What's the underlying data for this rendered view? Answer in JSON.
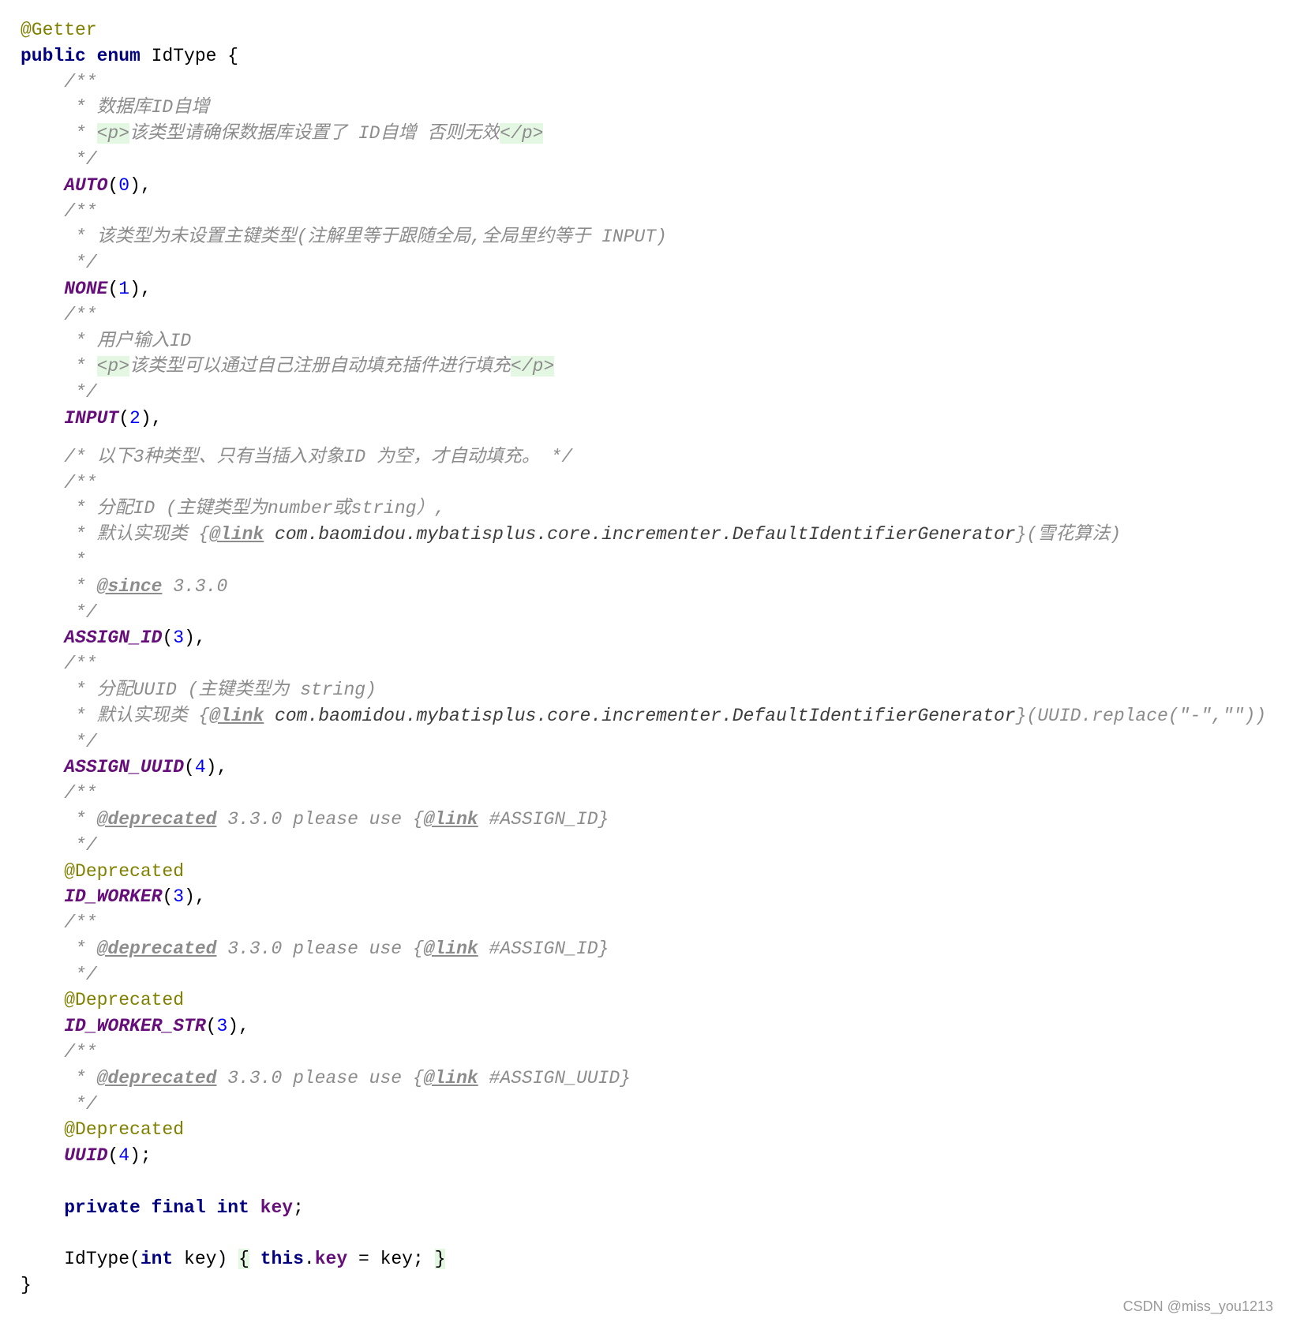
{
  "editor": {
    "language": "java",
    "lines": [
      {
        "segs": [
          [
            "ann",
            "@Getter"
          ]
        ]
      },
      {
        "segs": [
          [
            "kw",
            "public enum "
          ],
          [
            "plain",
            "IdType {"
          ]
        ]
      },
      {
        "segs": [
          [
            "cm",
            "    /**"
          ]
        ]
      },
      {
        "segs": [
          [
            "cm",
            "     * 数据库ID自增"
          ]
        ]
      },
      {
        "segs": [
          [
            "cm",
            "     * "
          ],
          [
            "tag",
            "<p>"
          ],
          [
            "cm",
            "该类型请确保数据库设置了 ID自增 否则无效"
          ],
          [
            "tag",
            "</p>"
          ]
        ]
      },
      {
        "segs": [
          [
            "cm",
            "     */"
          ]
        ]
      },
      {
        "segs": [
          [
            "plain",
            "    "
          ],
          [
            "const",
            "AUTO"
          ],
          [
            "plain",
            "("
          ],
          [
            "num",
            "0"
          ],
          [
            "plain",
            "),"
          ]
        ]
      },
      {
        "segs": [
          [
            "cm",
            "    /**"
          ]
        ]
      },
      {
        "segs": [
          [
            "cm",
            "     * 该类型为未设置主键类型(注解里等于跟随全局,全局里约等于 INPUT)"
          ]
        ]
      },
      {
        "segs": [
          [
            "cm",
            "     */"
          ]
        ]
      },
      {
        "segs": [
          [
            "plain",
            "    "
          ],
          [
            "const",
            "NONE"
          ],
          [
            "plain",
            "("
          ],
          [
            "num",
            "1"
          ],
          [
            "plain",
            "),"
          ]
        ]
      },
      {
        "segs": [
          [
            "cm",
            "    /**"
          ]
        ]
      },
      {
        "segs": [
          [
            "cm",
            "     * 用户输入ID"
          ]
        ]
      },
      {
        "segs": [
          [
            "cm",
            "     * "
          ],
          [
            "tag",
            "<p>"
          ],
          [
            "cm",
            "该类型可以通过自己注册自动填充插件进行填充"
          ],
          [
            "tag",
            "</p>"
          ]
        ]
      },
      {
        "segs": [
          [
            "cm",
            "     */"
          ]
        ]
      },
      {
        "segs": [
          [
            "plain",
            "    "
          ],
          [
            "const",
            "INPUT"
          ],
          [
            "plain",
            "("
          ],
          [
            "num",
            "2"
          ],
          [
            "plain",
            "),"
          ]
        ]
      },
      {
        "gap": "half",
        "segs": [
          [
            "cm",
            "    /* 以下3种类型、只有当插入对象ID 为空，才自动填充。 */"
          ]
        ]
      },
      {
        "segs": [
          [
            "cm",
            "    /**"
          ]
        ]
      },
      {
        "segs": [
          [
            "cm",
            "     * 分配ID (主键类型为number或string）,"
          ]
        ]
      },
      {
        "segs": [
          [
            "cm",
            "     * 默认实现类 {"
          ],
          [
            "doctag",
            "@link"
          ],
          [
            "ref",
            " com.baomidou.mybatisplus.core.incrementer.DefaultIdentifierGenerator"
          ],
          [
            "cm",
            "}(雪花算法)"
          ]
        ]
      },
      {
        "segs": [
          [
            "cm",
            "     *"
          ]
        ]
      },
      {
        "segs": [
          [
            "cm",
            "     * "
          ],
          [
            "doctag",
            "@since"
          ],
          [
            "cm",
            " 3.3.0"
          ]
        ]
      },
      {
        "segs": [
          [
            "cm",
            "     */"
          ]
        ]
      },
      {
        "segs": [
          [
            "plain",
            "    "
          ],
          [
            "const",
            "ASSIGN_ID"
          ],
          [
            "plain",
            "("
          ],
          [
            "num",
            "3"
          ],
          [
            "plain",
            "),"
          ]
        ]
      },
      {
        "segs": [
          [
            "cm",
            "    /**"
          ]
        ]
      },
      {
        "segs": [
          [
            "cm",
            "     * 分配UUID (主键类型为 string)"
          ]
        ]
      },
      {
        "segs": [
          [
            "cm",
            "     * 默认实现类 {"
          ],
          [
            "doctag",
            "@link"
          ],
          [
            "ref",
            " com.baomidou.mybatisplus.core.incrementer.DefaultIdentifierGenerator"
          ],
          [
            "cm",
            "}(UUID.replace(\"-\",\"\"))"
          ]
        ]
      },
      {
        "segs": [
          [
            "cm",
            "     */"
          ]
        ]
      },
      {
        "segs": [
          [
            "plain",
            "    "
          ],
          [
            "const",
            "ASSIGN_UUID"
          ],
          [
            "plain",
            "("
          ],
          [
            "num",
            "4"
          ],
          [
            "plain",
            "),"
          ]
        ]
      },
      {
        "segs": [
          [
            "cm",
            "    /**"
          ]
        ]
      },
      {
        "segs": [
          [
            "cm",
            "     * "
          ],
          [
            "doctag",
            "@deprecated"
          ],
          [
            "cm",
            " 3.3.0 please use {"
          ],
          [
            "doctag",
            "@link"
          ],
          [
            "cm",
            " #ASSIGN_ID}"
          ]
        ]
      },
      {
        "segs": [
          [
            "cm",
            "     */"
          ]
        ]
      },
      {
        "segs": [
          [
            "ann",
            "    @Deprecated"
          ]
        ]
      },
      {
        "segs": [
          [
            "plain",
            "    "
          ],
          [
            "const",
            "ID_WORKER"
          ],
          [
            "plain",
            "("
          ],
          [
            "num",
            "3"
          ],
          [
            "plain",
            "),"
          ]
        ]
      },
      {
        "segs": [
          [
            "cm",
            "    /**"
          ]
        ]
      },
      {
        "segs": [
          [
            "cm",
            "     * "
          ],
          [
            "doctag",
            "@deprecated"
          ],
          [
            "cm",
            " 3.3.0 please use {"
          ],
          [
            "doctag",
            "@link"
          ],
          [
            "cm",
            " #ASSIGN_ID}"
          ]
        ]
      },
      {
        "segs": [
          [
            "cm",
            "     */"
          ]
        ]
      },
      {
        "segs": [
          [
            "ann",
            "    @Deprecated"
          ]
        ]
      },
      {
        "segs": [
          [
            "plain",
            "    "
          ],
          [
            "const",
            "ID_WORKER_STR"
          ],
          [
            "plain",
            "("
          ],
          [
            "num",
            "3"
          ],
          [
            "plain",
            "),"
          ]
        ]
      },
      {
        "segs": [
          [
            "cm",
            "    /**"
          ]
        ]
      },
      {
        "segs": [
          [
            "cm",
            "     * "
          ],
          [
            "doctag",
            "@deprecated"
          ],
          [
            "cm",
            " 3.3.0 please use {"
          ],
          [
            "doctag",
            "@link"
          ],
          [
            "cm",
            " #ASSIGN_UUID}"
          ]
        ]
      },
      {
        "segs": [
          [
            "cm",
            "     */"
          ]
        ]
      },
      {
        "segs": [
          [
            "ann",
            "    @Deprecated"
          ]
        ]
      },
      {
        "segs": [
          [
            "plain",
            "    "
          ],
          [
            "const",
            "UUID"
          ],
          [
            "plain",
            "("
          ],
          [
            "num",
            "4"
          ],
          [
            "plain",
            ");"
          ]
        ]
      },
      {
        "gap": "one",
        "segs": [
          [
            "plain",
            "    "
          ],
          [
            "kw",
            "private final int "
          ],
          [
            "field",
            "key"
          ],
          [
            "plain",
            ";"
          ]
        ]
      },
      {
        "gap": "one",
        "segs": [
          [
            "plain",
            "    IdType("
          ],
          [
            "kw",
            "int"
          ],
          [
            "plain",
            " key) "
          ],
          [
            "brace",
            "{"
          ],
          [
            "plain",
            " "
          ],
          [
            "kw",
            "this"
          ],
          [
            "plain",
            "."
          ],
          [
            "field",
            "key"
          ],
          [
            "plain",
            " = key; "
          ],
          [
            "brace",
            "}"
          ]
        ]
      },
      {
        "segs": [
          [
            "plain",
            "}"
          ]
        ]
      }
    ]
  },
  "watermark": "CSDN @miss_you1213"
}
